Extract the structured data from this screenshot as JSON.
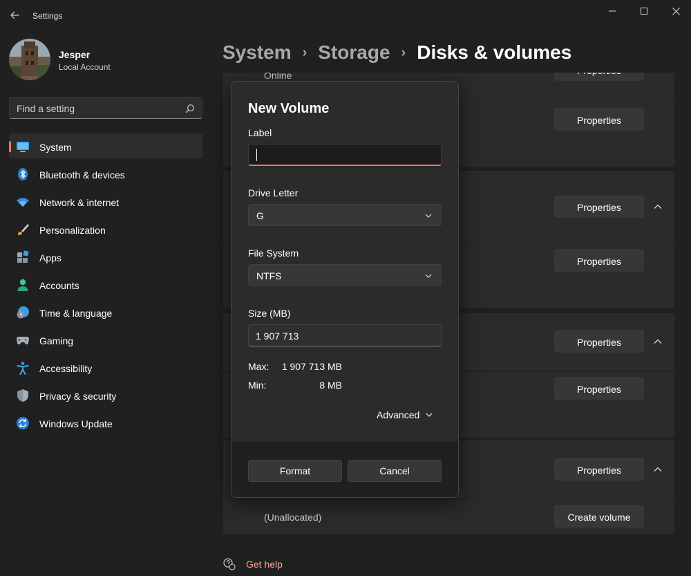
{
  "window": {
    "app_title": "Settings"
  },
  "profile": {
    "name": "Jesper",
    "account_type": "Local Account"
  },
  "search": {
    "placeholder": "Find a setting"
  },
  "nav": {
    "items": [
      {
        "label": "System",
        "icon": "system-icon",
        "active": true
      },
      {
        "label": "Bluetooth & devices",
        "icon": "bluetooth-icon"
      },
      {
        "label": "Network & internet",
        "icon": "wifi-icon"
      },
      {
        "label": "Personalization",
        "icon": "brush-icon"
      },
      {
        "label": "Apps",
        "icon": "apps-icon"
      },
      {
        "label": "Accounts",
        "icon": "accounts-icon"
      },
      {
        "label": "Time & language",
        "icon": "time-language-icon"
      },
      {
        "label": "Gaming",
        "icon": "gamepad-icon"
      },
      {
        "label": "Accessibility",
        "icon": "accessibility-icon"
      },
      {
        "label": "Privacy & security",
        "icon": "shield-icon"
      },
      {
        "label": "Windows Update",
        "icon": "update-icon"
      }
    ]
  },
  "breadcrumb": {
    "items": [
      "System",
      "Storage",
      "Disks & volumes"
    ]
  },
  "content": {
    "partial_status": "Online",
    "properties_label": "Properties",
    "unallocated_label": "(Unallocated)",
    "create_volume_label": "Create volume"
  },
  "help": {
    "label": "Get help"
  },
  "dialog": {
    "title": "New Volume",
    "label_field": {
      "label": "Label",
      "value": ""
    },
    "drive_letter": {
      "label": "Drive Letter",
      "value": "G"
    },
    "file_system": {
      "label": "File System",
      "value": "NTFS"
    },
    "size": {
      "label": "Size (MB)",
      "value": "1 907 713"
    },
    "max": {
      "key": "Max:",
      "value": "1 907 713 MB"
    },
    "min": {
      "key": "Min:",
      "value": "8 MB"
    },
    "advanced_label": "Advanced",
    "format_label": "Format",
    "cancel_label": "Cancel"
  },
  "colors": {
    "accent": "#f0785a",
    "background": "#202020",
    "card": "#2b2b2b"
  }
}
